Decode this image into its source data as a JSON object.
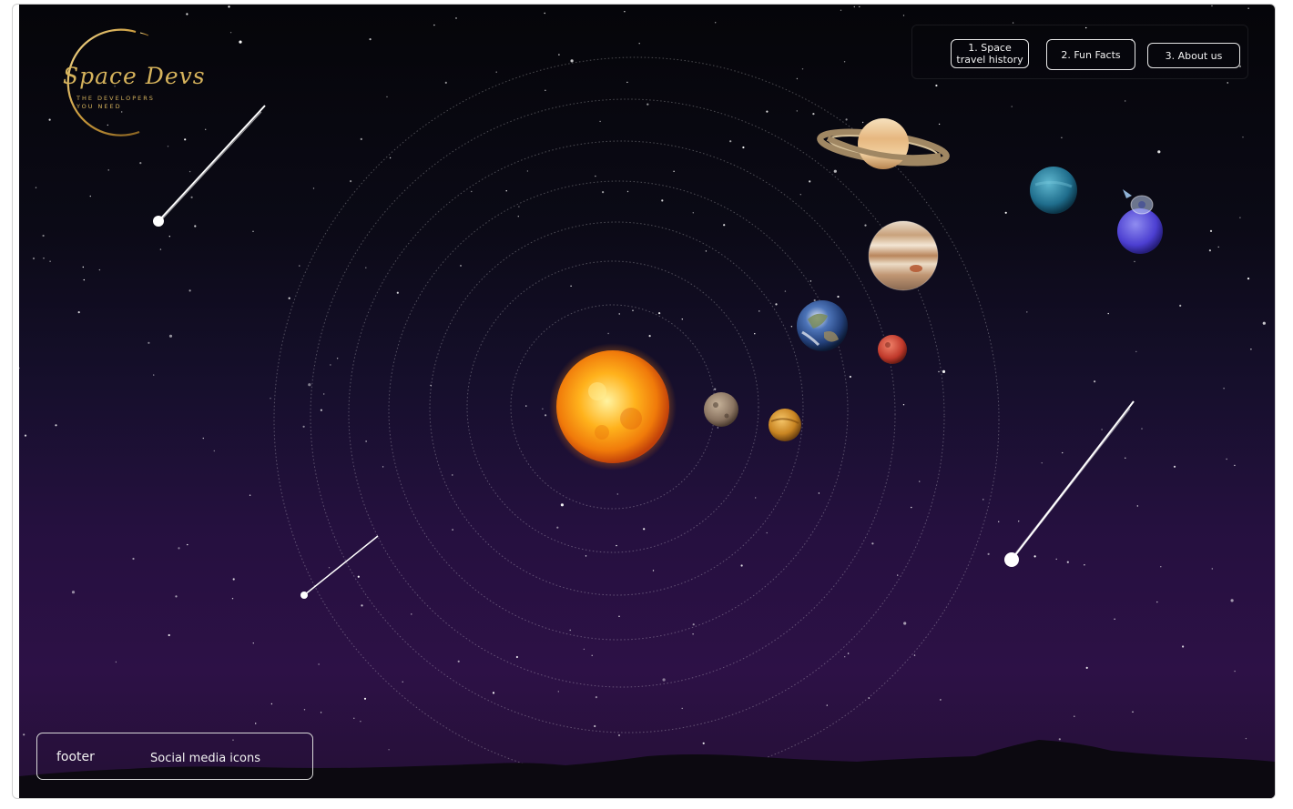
{
  "logo": {
    "name": "Space Devs",
    "tagline_line1": "THE DEVELOPERS",
    "tagline_line2": "YOU NEED"
  },
  "nav": {
    "items": [
      {
        "label_line1": "1. Space",
        "label_line2": "travel history"
      },
      {
        "label": "2. Fun Facts"
      },
      {
        "label": "3. About us"
      }
    ]
  },
  "footer": {
    "label": "footer",
    "social": "Social media icons"
  },
  "colors": {
    "accent_gold": "#d6b35c",
    "sky_top": "#050509",
    "sky_bottom": "#2d1146"
  },
  "planets": [
    "Mercury",
    "Venus",
    "Earth",
    "Mars",
    "Jupiter",
    "Saturn",
    "Uranus",
    "Neptune"
  ]
}
